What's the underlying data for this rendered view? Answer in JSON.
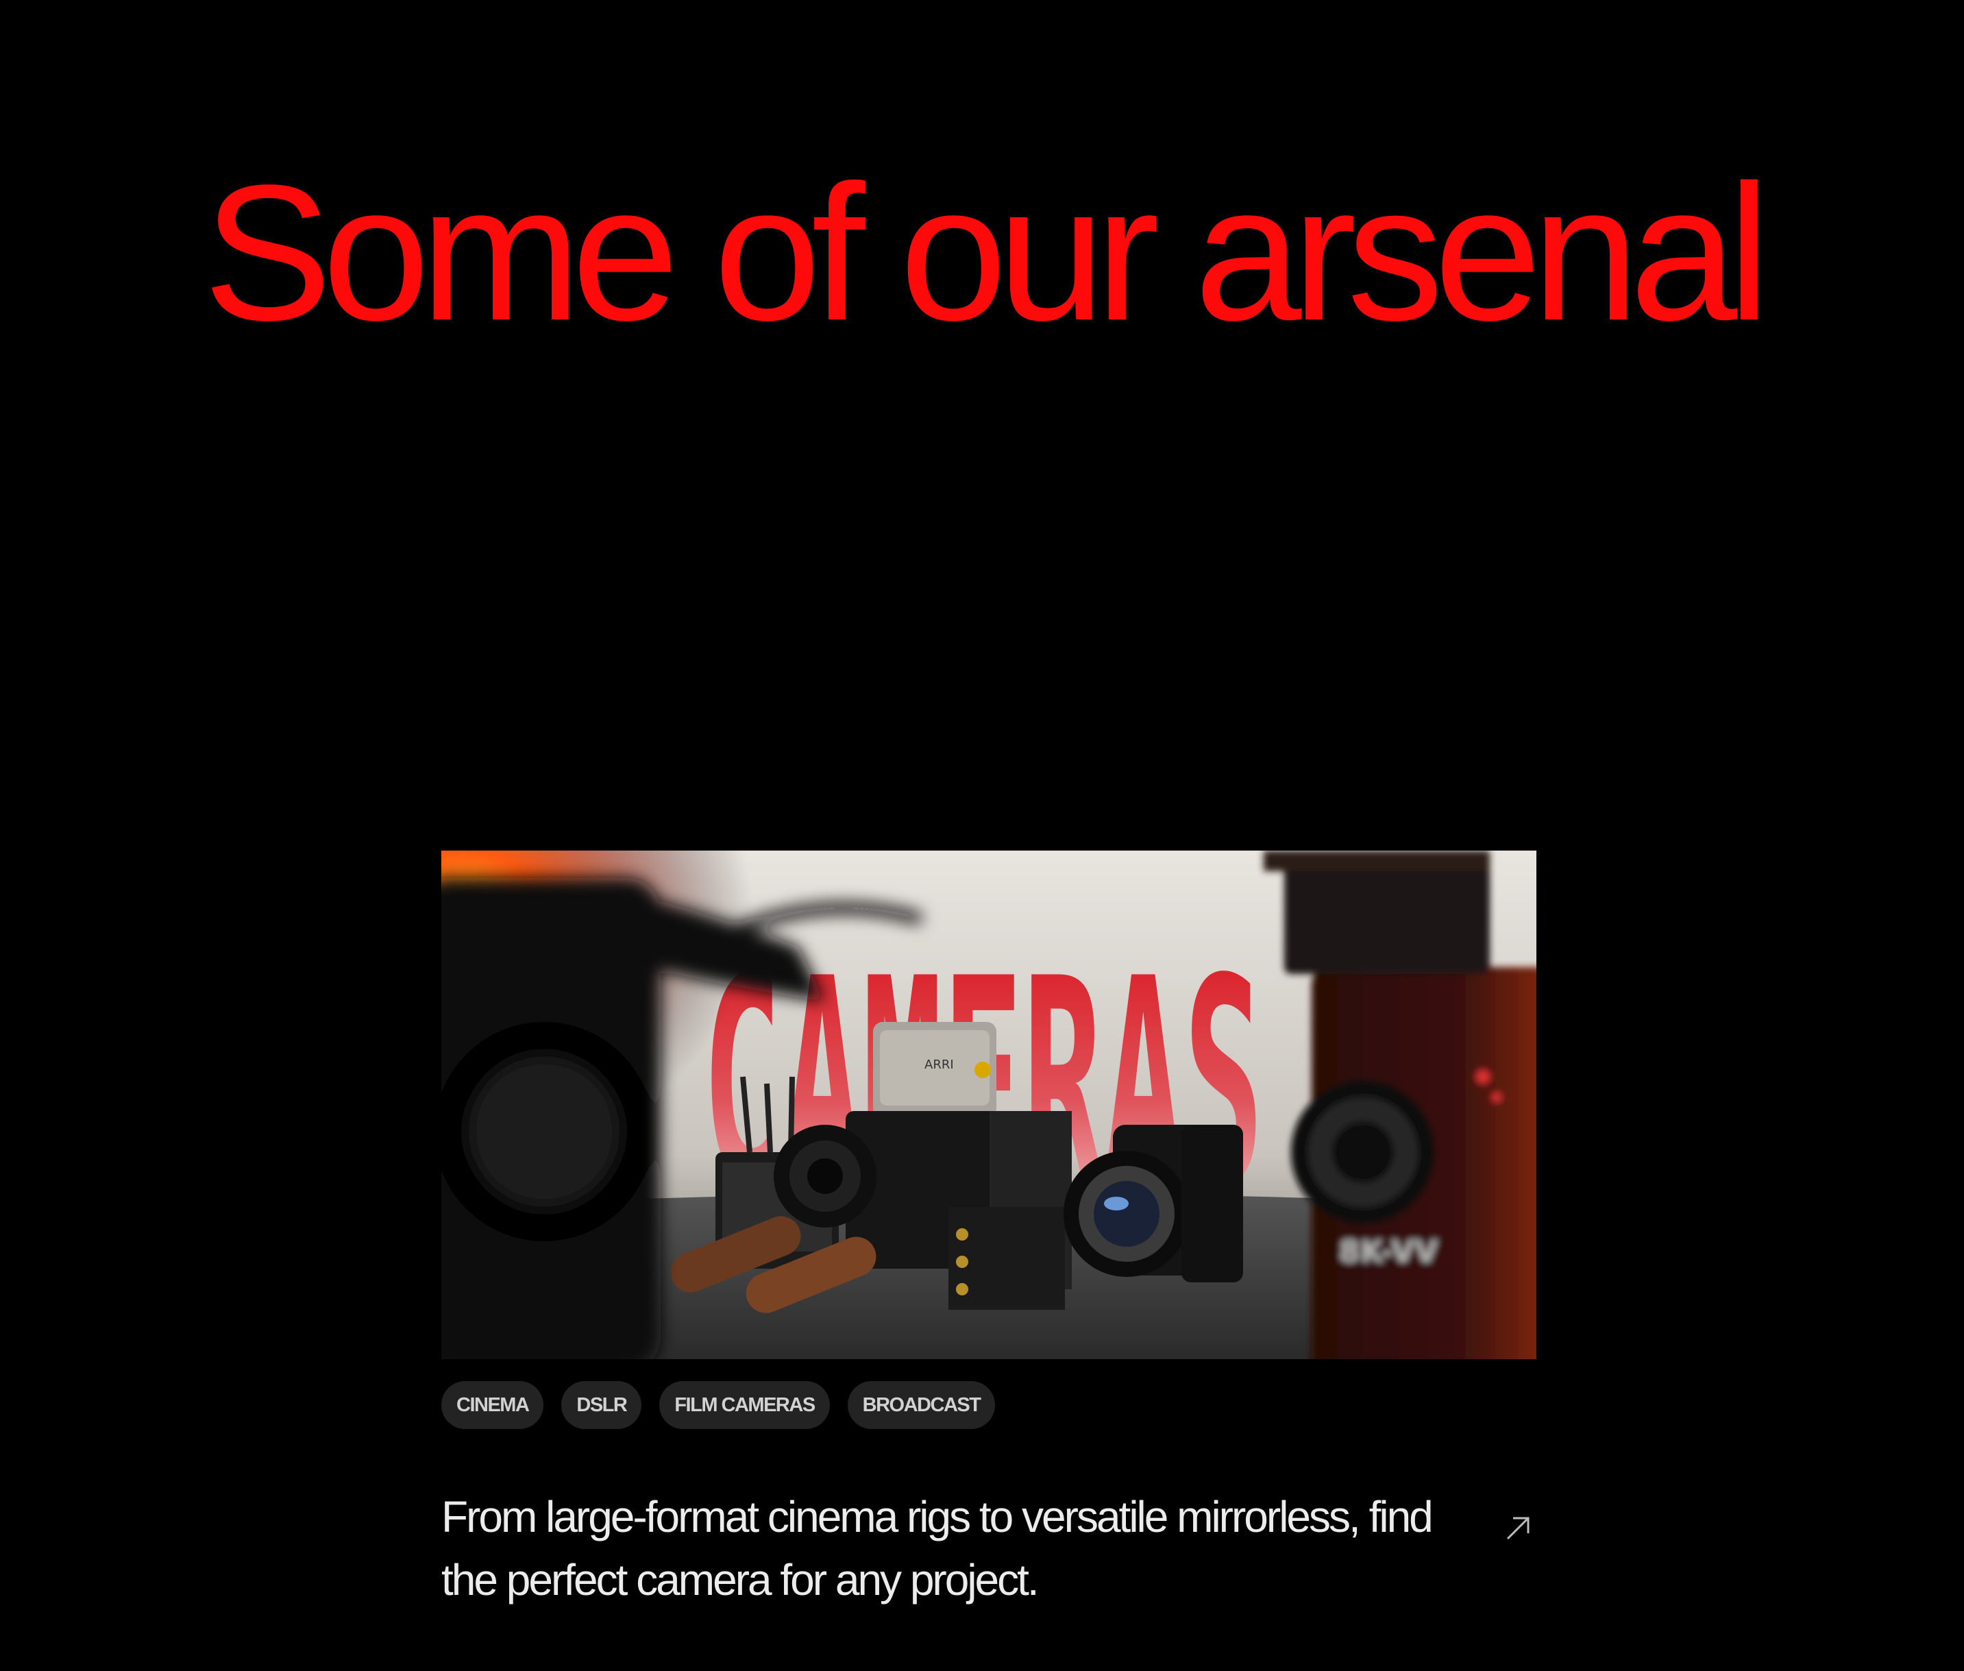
{
  "header": {
    "title": "Some of our arsenal"
  },
  "card": {
    "image_caption": "CAMERAS",
    "image_labels": {
      "camera_brand": "ARRI",
      "body_model": "8K-VV"
    },
    "tags": [
      "CINEMA",
      "DSLR",
      "FILM CAMERAS",
      "BROADCAST"
    ],
    "description": "From large-format cinema rigs to versatile mirrorless, find the perfect camera for any project.",
    "arrow_icon": "arrow-up-right-icon"
  },
  "colors": {
    "background": "#000000",
    "title": "#ff0a0a",
    "tag_background": "#232323",
    "tag_text": "#d2d2d2",
    "description_text": "#ececec"
  }
}
